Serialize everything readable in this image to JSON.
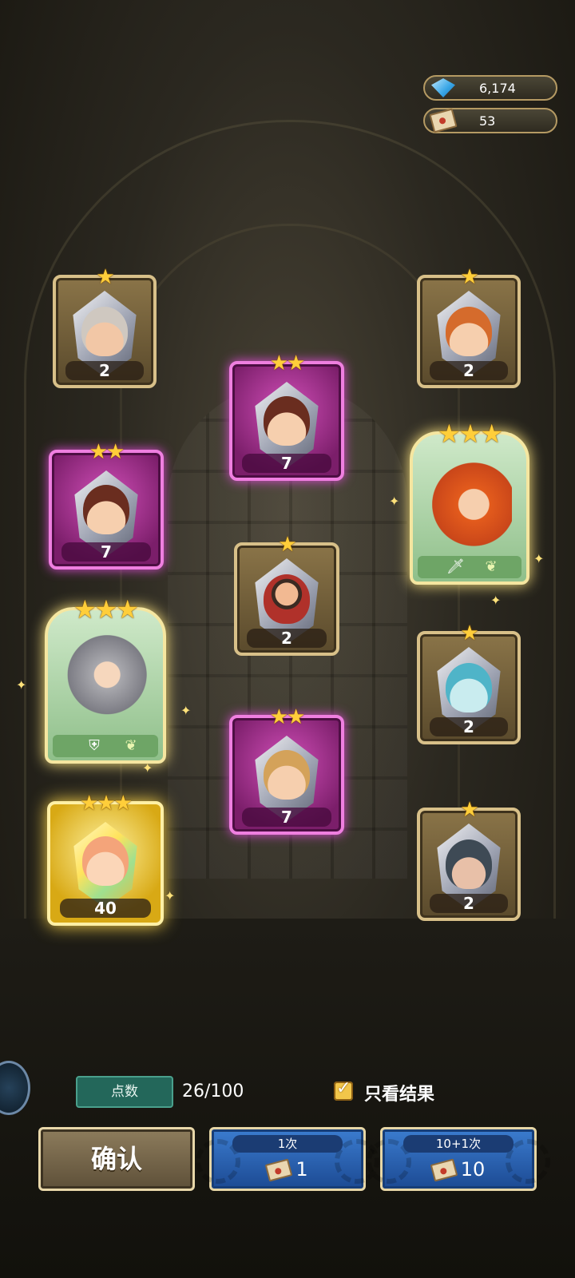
{
  "currency": {
    "gems": "6,174",
    "tickets": "53"
  },
  "cards": [
    {
      "stars": "★",
      "count": "2",
      "rarity": "bronze",
      "hair": "#cfc8c0",
      "skin": "#f2c7a6"
    },
    {
      "stars": "★",
      "count": "2",
      "rarity": "bronze",
      "hair": "#d56b2c",
      "skin": "#f6cfae"
    },
    {
      "stars": "★★",
      "count": "7",
      "rarity": "purple",
      "hair": "#6a2d1f",
      "skin": "#f6cfae"
    },
    {
      "stars": "★★",
      "count": "7",
      "rarity": "purple",
      "hair": "#6a2d1f",
      "skin": "#f6cfae"
    },
    {
      "stars": "★★★",
      "rarity": "green",
      "hair": "#e35b1c"
    },
    {
      "stars": "★",
      "count": "2",
      "rarity": "bronze",
      "hair": "#3b2a22",
      "skin": "#f2b992"
    },
    {
      "stars": "★★★",
      "rarity": "green",
      "hair": "#a8a8ad"
    },
    {
      "stars": "★",
      "count": "2",
      "rarity": "bronze",
      "hair": "#4fb4c8",
      "skin": "#c9ecef"
    },
    {
      "stars": "★★",
      "count": "7",
      "rarity": "purple",
      "hair": "#d4a25a",
      "skin": "#f6cfae"
    },
    {
      "stars": "★★★",
      "count": "40",
      "rarity": "gold",
      "hair": "#f4a47a",
      "skin": "#fbd6b8"
    },
    {
      "stars": "★",
      "count": "2",
      "rarity": "bronze",
      "hair": "#3e4a55",
      "skin": "#e8c0a8"
    }
  ],
  "tags": {
    "hero_a": [
      "sword-icon",
      "leaf-icon"
    ],
    "hero_b": [
      "shield-icon",
      "leaf-icon"
    ]
  },
  "bottom": {
    "points_label": "点数",
    "points_value": "26/100",
    "result_only_label": "只看结果",
    "result_only_checked": true,
    "confirm_label": "确认",
    "draw_once_label": "1次",
    "draw_once_cost": "1",
    "draw_multi_label": "10+1次",
    "draw_multi_cost": "10"
  },
  "colors": {
    "accent_gold": "#ffce3a",
    "button_blue": "#2a62b3",
    "points_green": "#23675a"
  }
}
